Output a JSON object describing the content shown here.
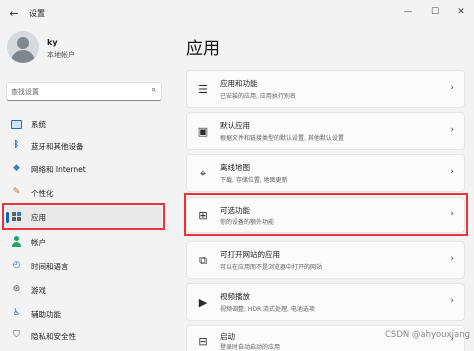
{
  "window": {
    "title": "设置",
    "back_icon": "←",
    "minimize_icon": "—",
    "maximize_icon": "☐",
    "close_icon": "✕"
  },
  "user": {
    "name": "ky",
    "account_type": "本地帐户"
  },
  "search": {
    "placeholder": "查找设置",
    "icon": "⌕"
  },
  "nav": {
    "items": [
      {
        "label": "系统",
        "icon": "system-icon"
      },
      {
        "label": "蓝牙和其他设备",
        "icon": "bluetooth-icon",
        "glyph": "ᛒ"
      },
      {
        "label": "网络和 Internet",
        "icon": "wifi-icon",
        "glyph": "◆"
      },
      {
        "label": "个性化",
        "icon": "brush-icon",
        "glyph": "✎"
      },
      {
        "label": "应用",
        "icon": "apps-icon",
        "selected": true
      },
      {
        "label": "帐户",
        "icon": "account-icon"
      },
      {
        "label": "时间和语言",
        "icon": "globe-icon",
        "glyph": "◴"
      },
      {
        "label": "游戏",
        "icon": "gamepad-icon",
        "glyph": "⊛"
      },
      {
        "label": "辅助功能",
        "icon": "accessibility-icon",
        "glyph": "♿"
      },
      {
        "label": "隐私和安全性",
        "icon": "shield-icon",
        "glyph": "⛉"
      }
    ]
  },
  "main": {
    "title": "应用",
    "cards": [
      {
        "title": "应用和功能",
        "desc": "已安装的应用, 应用执行别名",
        "glyph": "☰",
        "icon": "list-icon"
      },
      {
        "title": "默认应用",
        "desc": "根据文件和链接类型的默认设置, 其他默认设置",
        "glyph": "▣",
        "icon": "default-apps-icon"
      },
      {
        "title": "离线地图",
        "desc": "下载, 存储位置, 地图更新",
        "glyph": "⌖",
        "icon": "map-icon"
      },
      {
        "title": "可选功能",
        "desc": "你的设备的额外功能",
        "glyph": "⊞",
        "icon": "optional-features-icon"
      },
      {
        "title": "可打开网站的应用",
        "desc": "可以在应用而不是浏览器中打开的网站",
        "glyph": "⧉",
        "icon": "open-link-icon"
      },
      {
        "title": "视频播放",
        "desc": "视频调整, HDR 流式处理, 电池选项",
        "glyph": "▶",
        "icon": "video-icon"
      },
      {
        "title": "启动",
        "desc": "登录时自动启动的应用",
        "glyph": "⊟",
        "icon": "startup-icon"
      }
    ],
    "chevron": "›"
  },
  "watermark": "CSDN @ahyouxiang",
  "colors": {
    "accent": "#0067c0",
    "highlight": "#e8343a"
  }
}
